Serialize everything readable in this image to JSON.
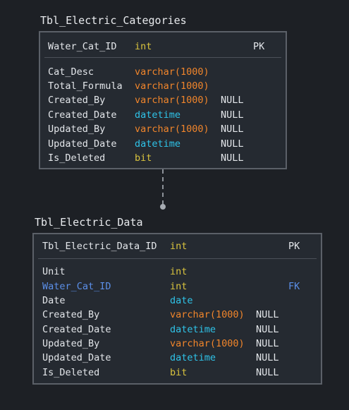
{
  "tables": [
    {
      "title": "Tbl_Electric_Categories",
      "pk_column": {
        "name": "Water_Cat_ID",
        "type": "int",
        "key": "PK"
      },
      "columns": [
        {
          "name": "Cat_Desc",
          "type": "varchar(1000)",
          "null": ""
        },
        {
          "name": "Total_Formula",
          "type": "varchar(1000)",
          "null": ""
        },
        {
          "name": "Created_By",
          "type": "varchar(1000)",
          "null": "NULL"
        },
        {
          "name": "Created_Date",
          "type": "datetime",
          "null": "NULL"
        },
        {
          "name": "Updated_By",
          "type": "varchar(1000)",
          "null": "NULL"
        },
        {
          "name": "Updated_Date",
          "type": "datetime",
          "null": "NULL"
        },
        {
          "name": "Is_Deleted",
          "type": "bit",
          "null": "NULL"
        }
      ]
    },
    {
      "title": "Tbl_Electric_Data",
      "pk_column": {
        "name": "Tbl_Electric_Data_ID",
        "type": "int",
        "key": "PK"
      },
      "columns": [
        {
          "name": "Unit",
          "type": "int",
          "null": ""
        },
        {
          "name": "Water_Cat_ID",
          "type": "int",
          "null": "",
          "key": "FK"
        },
        {
          "name": "Date",
          "type": "date",
          "null": ""
        },
        {
          "name": "Created_By",
          "type": "varchar(1000)",
          "null": "NULL"
        },
        {
          "name": "Created_Date",
          "type": "datetime",
          "null": "NULL"
        },
        {
          "name": "Updated_By",
          "type": "varchar(1000)",
          "null": "NULL"
        },
        {
          "name": "Updated_Date",
          "type": "datetime",
          "null": "NULL"
        },
        {
          "name": "Is_Deleted",
          "type": "bit",
          "null": "NULL"
        }
      ]
    }
  ],
  "colors": {
    "background": "#1d2025",
    "box": "#252a31",
    "border": "#5b6068",
    "int_type": "#d9c33e",
    "varchar_type": "#f0852b",
    "datetime_type": "#2fc3e8",
    "foreign_key": "#5b8fe8"
  }
}
